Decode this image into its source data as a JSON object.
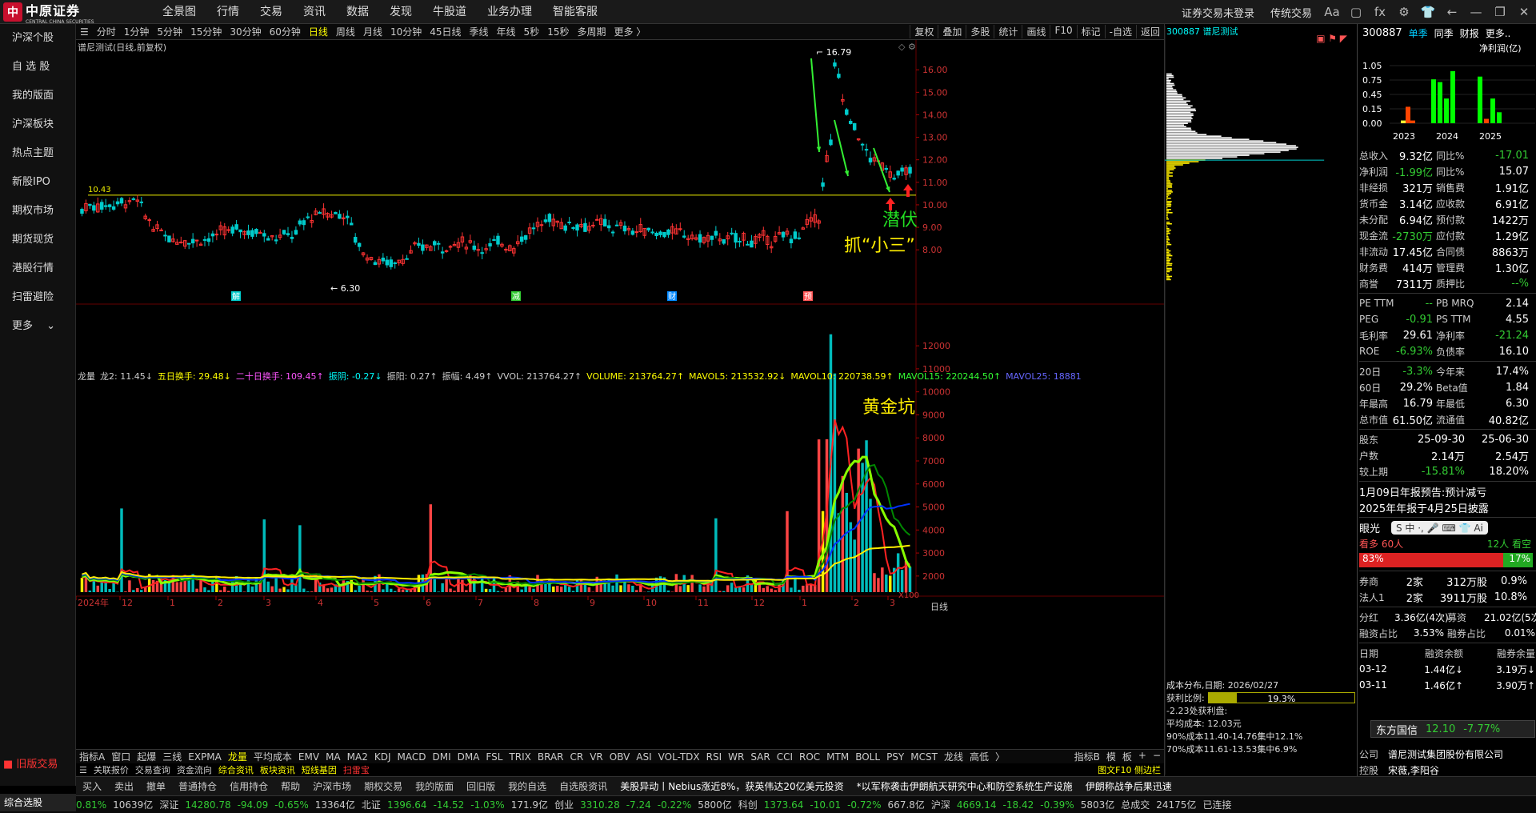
{
  "brand": {
    "logo_text": "中原证券",
    "logo_sub": "CENTRAL CHINA SECURITIES"
  },
  "topmenu": [
    "全景图",
    "行情",
    "交易",
    "资讯",
    "数据",
    "发现",
    "牛股道",
    "业务办理",
    "智能客服"
  ],
  "topright": {
    "login": "证券交易未登录",
    "trad": "传统交易"
  },
  "sidebar": [
    "沪深个股",
    "自 选 股",
    "我的版面",
    "沪深板块",
    "热点主题",
    "新股IPO",
    "期权市场",
    "期货现货",
    "港股行情",
    "扫雷避险",
    "更多"
  ],
  "sidebar_bottom": {
    "old": "旧版交易",
    "zhxg": "综合选股"
  },
  "period": {
    "items": [
      "分时",
      "1分钟",
      "5分钟",
      "15分钟",
      "30分钟",
      "60分钟",
      "日线",
      "周线",
      "月线",
      "10分钟",
      "45日线",
      "季线",
      "年线",
      "5秒",
      "15秒",
      "多周期",
      "更多 〉"
    ],
    "active": "日线",
    "right": [
      "复权",
      "叠加",
      "多股",
      "统计",
      "画线",
      "F10",
      "标记",
      "-自选",
      "返回"
    ]
  },
  "chart": {
    "title": "谱尼测试(日线,前复权)",
    "high_label": "16.79",
    "low_label": "6.30",
    "left_high_label": "10.43",
    "ylabels": [
      "16.00",
      "15.00",
      "14.00",
      "13.00",
      "12.00",
      "11.00",
      "10.00",
      "9.00",
      "8.00"
    ],
    "ann_qianfu": "潜伏",
    "ann_xiaosan": "抓“小三”",
    "ann_huangjin": "黄金坑",
    "events": [
      "解",
      "减",
      "财",
      "预"
    ],
    "vlabels": [
      "12000",
      "11000",
      "10000",
      "9000",
      "8000",
      "7000",
      "6000",
      "5000",
      "4000",
      "3000",
      "2000"
    ],
    "xaxis": [
      "2024年",
      "12",
      "1",
      "2",
      "3",
      "4",
      "5",
      "6",
      "7",
      "8",
      "9",
      "10",
      "11",
      "12",
      "1",
      "2",
      "3"
    ],
    "x100": "X100",
    "rtday": "日线"
  },
  "ind_legend": [
    {
      "t": "龙量",
      "c": "#ccc"
    },
    {
      "t": "龙2: 11.45↓",
      "c": "#ccc"
    },
    {
      "t": "五日换手: 29.48↓",
      "c": "#ff0"
    },
    {
      "t": "二十日换手: 109.45↑",
      "c": "#f5f"
    },
    {
      "t": "振阴: -0.27↓",
      "c": "#0ff"
    },
    {
      "t": "振阳: 0.27↑",
      "c": "#ccc"
    },
    {
      "t": "振幅: 4.49↑",
      "c": "#ccc"
    },
    {
      "t": "VVOL: 213764.27↑",
      "c": "#ccc"
    },
    {
      "t": "VOLUME: 213764.27↑",
      "c": "#ff0"
    },
    {
      "t": "MAVOL5: 213532.92↓",
      "c": "#ff0"
    },
    {
      "t": "MAVOL10: 220738.59↑",
      "c": "#ff0"
    },
    {
      "t": "MAVOL15: 220244.50↑",
      "c": "#3f3"
    },
    {
      "t": "MAVOL25: 18881",
      "c": "#66f"
    }
  ],
  "tabs": [
    "指标A",
    "窗口",
    "起爆",
    "三线",
    "EXPMA",
    "龙量",
    "平均成本",
    "EMV",
    "MA",
    "MA2",
    "KDJ",
    "MACD",
    "DMI",
    "DMA",
    "FSL",
    "TRIX",
    "BRAR",
    "CR",
    "VR",
    "OBV",
    "ASI",
    "VOL-TDX",
    "RSI",
    "WR",
    "SAR",
    "CCI",
    "ROC",
    "MTM",
    "BOLL",
    "PSY",
    "MCST",
    "龙线",
    "高低",
    "〉"
  ],
  "tabs_active": "龙量",
  "tabs_right": [
    "指标B",
    "模",
    "板",
    "+",
    "−"
  ],
  "links": [
    {
      "t": "关联报价",
      "c": "#ccc"
    },
    {
      "t": "交易查询",
      "c": "#ccc"
    },
    {
      "t": "资金流向",
      "c": "#ccc"
    },
    {
      "t": "综合资讯",
      "c": "#ff0"
    },
    {
      "t": "板块资讯",
      "c": "#ff0"
    },
    {
      "t": "短线基因",
      "c": "#ff0"
    },
    {
      "t": "扫雷宝",
      "c": "#f33"
    }
  ],
  "links_right": "图文F10  侧边栏",
  "profile": {
    "code": "300887",
    "name": "谱尼测试",
    "cost_date": "成本分布,日期: 2026/02/27",
    "profit_ratio_label": "获利比例:",
    "profit_ratio": "19.3%",
    "profit_at": "-2.23处获利盘:",
    "avg_cost": "平均成本: 12.03元",
    "c90": "90%成本11.40-14.76集中12.1%",
    "c70": "70%成本11.61-13.53集中6.9%"
  },
  "rpanel": {
    "code": "300887",
    "tabs": [
      "单季",
      "同季",
      "财报",
      "更多.."
    ],
    "profit_title": "净利润(亿)",
    "yaxis": [
      "1.05",
      "0.75",
      "0.45",
      "0.15",
      "0.00"
    ],
    "years": [
      "2023",
      "2024",
      "2025"
    ],
    "fin": [
      [
        "总收入",
        "9.32亿",
        "同比%",
        "-17.01"
      ],
      [
        "净利润",
        "-1.99亿",
        "同比%",
        "15.07"
      ],
      [
        "非经损",
        "321万",
        "销售费",
        "1.91亿"
      ],
      [
        "货币金",
        "3.14亿",
        "应收款",
        "6.91亿"
      ],
      [
        "未分配",
        "6.94亿",
        "预付款",
        "1422万"
      ],
      [
        "现金流",
        "-2730万",
        "应付款",
        "1.29亿"
      ],
      [
        "非流动",
        "17.45亿",
        "合同债",
        "8863万"
      ],
      [
        "财务费",
        "414万",
        "管理费",
        "1.30亿"
      ],
      [
        "商誉",
        "7311万",
        "质押比",
        "--%"
      ]
    ],
    "val": [
      [
        "PE TTM",
        "--",
        "PB MRQ",
        "2.14"
      ],
      [
        "PEG",
        "-0.91",
        "PS TTM",
        "4.55"
      ],
      [
        "毛利率",
        "29.61",
        "净利率",
        "-21.24"
      ],
      [
        "ROE",
        "-6.93%",
        "负债率",
        "16.10"
      ]
    ],
    "perf": [
      [
        "20日",
        "-3.3%",
        "今年来",
        "17.4%"
      ],
      [
        "60日",
        "29.2%",
        "Beta值",
        "1.84"
      ],
      [
        "年最高",
        "16.79",
        "年最低",
        "6.30"
      ],
      [
        "总市值",
        "61.50亿",
        "流通值",
        "40.82亿"
      ]
    ],
    "holders": [
      [
        "股东",
        "25-09-30",
        "25-06-30"
      ],
      [
        "户数",
        "2.14万",
        "2.54万"
      ],
      [
        "较上期",
        "-15.81%",
        "18.20%"
      ]
    ],
    "notice1": "1月09日年报预告:预计减亏",
    "notice2": "2025年年报于4月25日披露",
    "eye": "眼光",
    "bear": "看多 60人",
    "bull": "12人 看空",
    "bear_pct": "83%",
    "bull_pct": "17%",
    "inst": [
      [
        "券商",
        "2家",
        "312万股",
        "0.9%"
      ],
      [
        "法人1",
        "2家",
        "3911万股",
        "10.8%"
      ]
    ],
    "div": [
      [
        "分红",
        "3.36亿(4次)",
        "募资",
        "21.02亿(5次)"
      ],
      [
        "融资占比",
        "3.53%",
        "融券占比",
        "0.01%"
      ]
    ],
    "margin_head": [
      "日期",
      "融资余额",
      "融券余量"
    ],
    "margin": [
      [
        "03-12",
        "1.44亿↓",
        "3.19万↓"
      ],
      [
        "03-11",
        "1.46亿↑",
        "3.90万↑"
      ]
    ],
    "popup": {
      "name": "东方国信",
      "price": "12.10",
      "chg": "-7.77%"
    },
    "company": "谱尼测试集团股份有限公司",
    "ctrl_label": "控股",
    "ctrl": "宋薇,李阳谷",
    "gs": "公司"
  },
  "bottombar": [
    "买入",
    "卖出",
    "撤单",
    "普通持仓",
    "信用持仓",
    "帮助",
    "沪深市场",
    "期权交易",
    "我的版面",
    "回旧版",
    "我的自选",
    "自选股资讯",
    "美股异动丨Nebius涨近8%，获英伟达20亿美元投资",
    "*以军称袭击伊朗航天研究中心和防空系统生产设施",
    "伊朗称战争后果迅速"
  ],
  "ticker": [
    {
      "t": "0.81%",
      "c": "#3c3"
    },
    {
      "t": "10639亿",
      "c": "#ccc"
    },
    {
      "t": "深证",
      "c": "#ccc"
    },
    {
      "t": "14280.78",
      "c": "#3c3"
    },
    {
      "t": "-94.09",
      "c": "#3c3"
    },
    {
      "t": "-0.65%",
      "c": "#3c3"
    },
    {
      "t": "13364亿",
      "c": "#ccc"
    },
    {
      "t": "北证",
      "c": "#ccc"
    },
    {
      "t": "1396.64",
      "c": "#3c3"
    },
    {
      "t": "-14.52",
      "c": "#3c3"
    },
    {
      "t": "-1.03%",
      "c": "#3c3"
    },
    {
      "t": "171.9亿",
      "c": "#ccc"
    },
    {
      "t": "创业",
      "c": "#ccc"
    },
    {
      "t": "3310.28",
      "c": "#3c3"
    },
    {
      "t": "-7.24",
      "c": "#3c3"
    },
    {
      "t": "-0.22%",
      "c": "#3c3"
    },
    {
      "t": "5800亿",
      "c": "#ccc"
    },
    {
      "t": "科创",
      "c": "#ccc"
    },
    {
      "t": "1373.64",
      "c": "#3c3"
    },
    {
      "t": "-10.01",
      "c": "#3c3"
    },
    {
      "t": "-0.72%",
      "c": "#3c3"
    },
    {
      "t": "667.8亿",
      "c": "#ccc"
    },
    {
      "t": "沪深",
      "c": "#ccc"
    },
    {
      "t": "4669.14",
      "c": "#3c3"
    },
    {
      "t": "-18.42",
      "c": "#3c3"
    },
    {
      "t": "-0.39%",
      "c": "#3c3"
    },
    {
      "t": "5803亿",
      "c": "#ccc"
    },
    {
      "t": "总成交",
      "c": "#ccc"
    },
    {
      "t": "24175亿",
      "c": "#ccc"
    },
    {
      "t": "已连接",
      "c": "#ccc"
    }
  ]
}
